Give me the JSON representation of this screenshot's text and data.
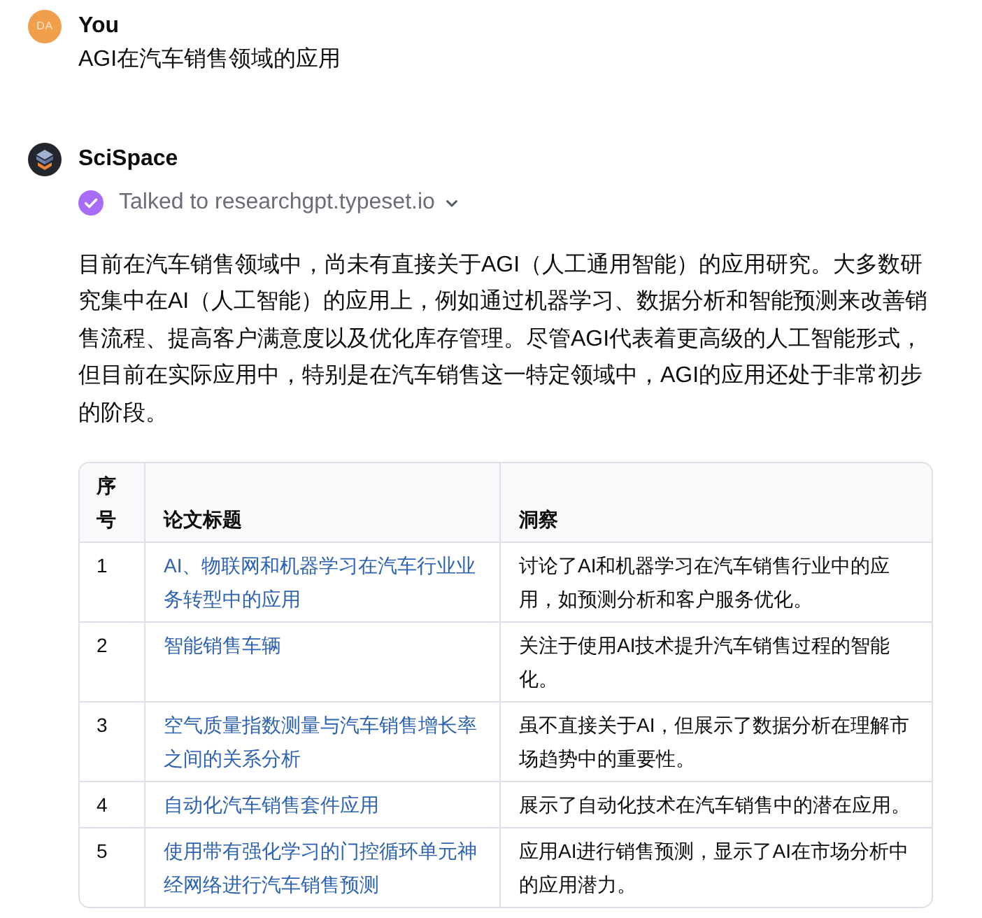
{
  "messages": [
    {
      "kind": "user",
      "author": "You",
      "avatar_initials": "DA",
      "text": "AGI在汽车销售领域的应用"
    },
    {
      "kind": "assistant",
      "author": "SciSpace",
      "tool_call": {
        "label": "Talked to researchgpt.typeset.io"
      },
      "text": "目前在汽车销售领域中，尚未有直接关于AGI（人工通用智能）的应用研究。大多数研究集中在AI（人工智能）的应用上，例如通过机器学习、数据分析和智能预测来改善销售流程、提高客户满意度以及优化库存管理。尽管AGI代表着更高级的人工智能形式，但目前在实际应用中，特别是在汽车销售这一特定领域中，AGI的应用还处于非常初步的阶段。",
      "table": {
        "columns": [
          "序号",
          "论文标题",
          "洞察"
        ],
        "rows": [
          {
            "number": "1",
            "title": "AI、物联网和机器学习在汽车行业业务转型中的应用",
            "insight": "讨论了AI和机器学习在汽车销售行业中的应用，如预测分析和客户服务优化。"
          },
          {
            "number": "2",
            "title": "智能销售车辆",
            "insight": "关注于使用AI技术提升汽车销售过程的智能化。"
          },
          {
            "number": "3",
            "title": "空气质量指数测量与汽车销售增长率之间的关系分析",
            "insight": "虽不直接关于AI，但展示了数据分析在理解市场趋势中的重要性。"
          },
          {
            "number": "4",
            "title": "自动化汽车销售套件应用",
            "insight": "展示了自动化技术在汽车销售中的潜在应用。"
          },
          {
            "number": "5",
            "title": "使用带有强化学习的门控循环单元神经网络进行汽车销售预测",
            "insight": "应用AI进行销售预测，显示了AI在市场分析中的应用潜力。"
          }
        ]
      }
    }
  ]
}
